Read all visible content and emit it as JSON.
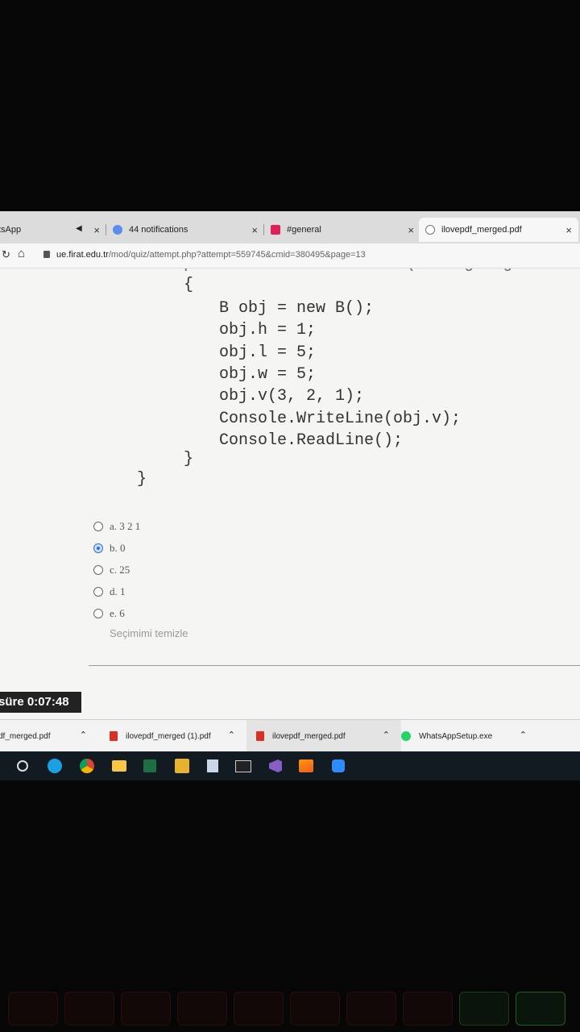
{
  "browser": {
    "tabs": [
      {
        "label": "tsApp",
        "icon": "whatsapp-icon"
      },
      {
        "label": "44 notifications",
        "icon": "chat-icon"
      },
      {
        "label": "#general",
        "icon": "slack-icon"
      },
      {
        "label": "ilovepdf_merged.pdf",
        "icon": "globe-icon"
      }
    ],
    "close_glyph": "×",
    "url_domain": "ue.firat.edu.tr",
    "url_path": "/mod/quiz/attempt.php?attempt=559745&cmid=380495&page=13"
  },
  "code": {
    "partial_line": "public static void Main(string args",
    "lines": [
      "{",
      "B obj = new B();",
      "obj.h = 1;",
      "obj.l = 5;",
      "obj.w = 5;",
      "obj.v(3, 2, 1);",
      "Console.WriteLine(obj.v);",
      "Console.ReadLine();",
      "}",
      "}"
    ]
  },
  "answers": [
    {
      "label": "a. 3 2 1",
      "selected": false
    },
    {
      "label": "b. 0",
      "selected": true
    },
    {
      "label": "c. 25",
      "selected": false
    },
    {
      "label": "d. 1",
      "selected": false
    },
    {
      "label": "e. 6",
      "selected": false
    }
  ],
  "clear_choice": "Seçimimi temizle",
  "timer": {
    "label": "süre",
    "value": "0:07:48"
  },
  "downloads": [
    {
      "label": "df_merged.pdf"
    },
    {
      "label": "ilovepdf_merged (1).pdf"
    },
    {
      "label": "ilovepdf_merged.pdf"
    },
    {
      "label": "WhatsAppSetup.exe"
    }
  ],
  "chevron_up_glyph": "⌃",
  "taskbar_apps": [
    "cortana-icon",
    "edge-icon",
    "chrome-icon",
    "file-explorer-icon",
    "excel-icon",
    "photos-icon",
    "box-icon",
    "terminal-icon",
    "visual-studio-icon",
    "sublime-icon",
    "zoom-icon"
  ],
  "colors": {
    "accent": "#2a6fdb",
    "taskbar": "#121a22"
  }
}
